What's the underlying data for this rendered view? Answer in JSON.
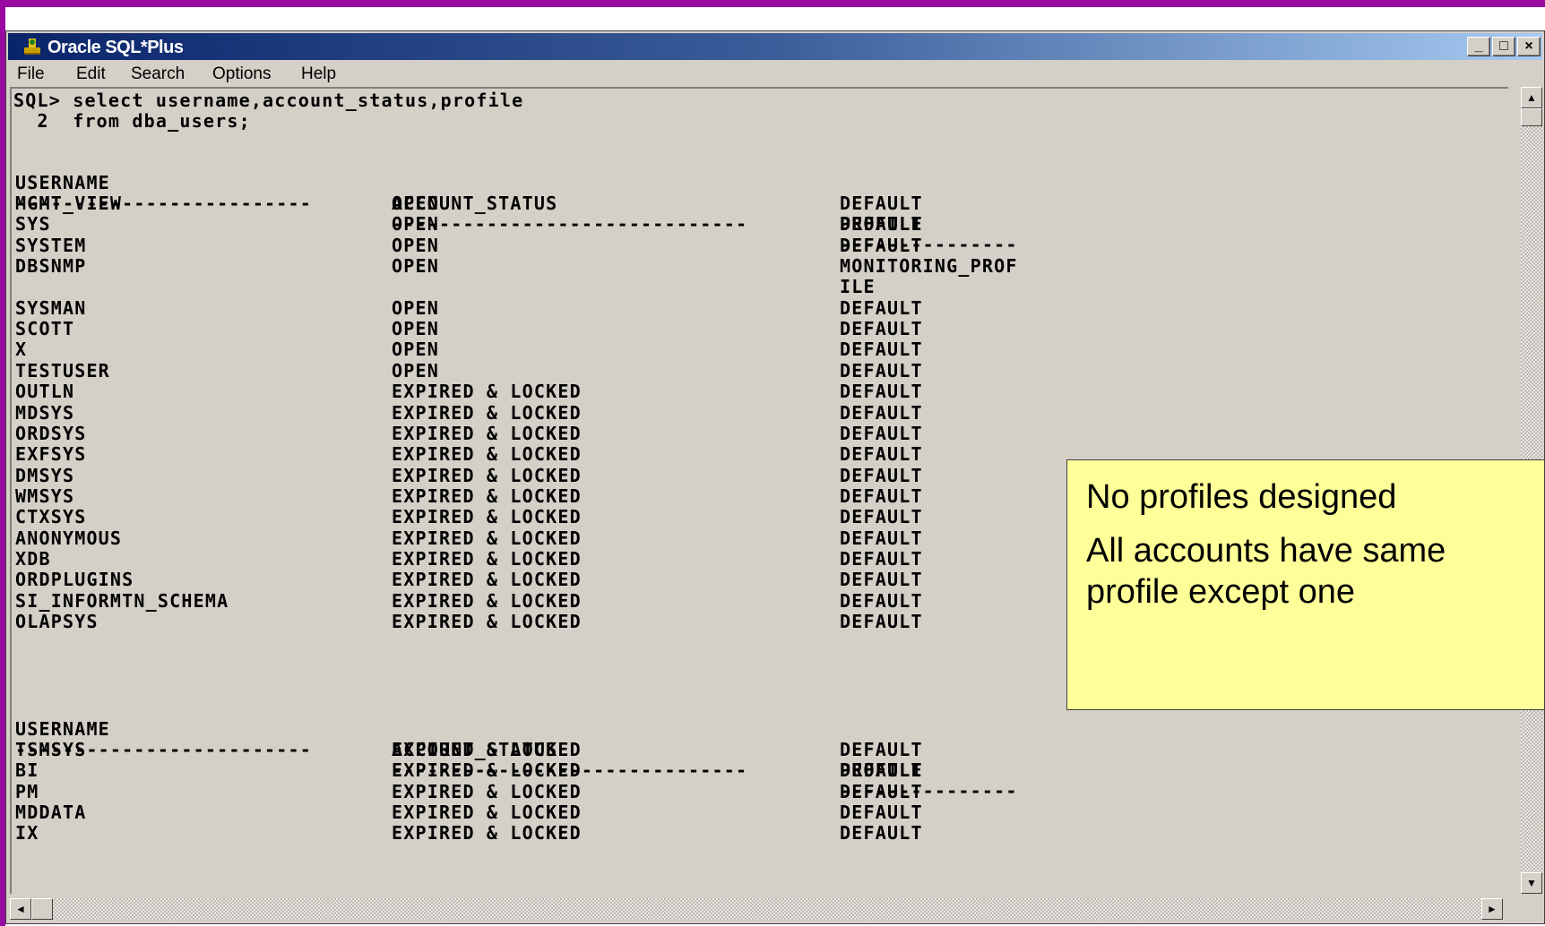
{
  "window": {
    "title": "Oracle SQL*Plus",
    "buttons": {
      "minimize": "_",
      "maximize": "□",
      "close": "×"
    }
  },
  "menu": [
    "File",
    "Edit",
    "Search",
    "Options",
    "Help"
  ],
  "console": {
    "prompt_line1": "SQL> select username,account_status,profile",
    "prompt_line2": "  2  from dba_users;",
    "headers": {
      "username": "USERNAME",
      "account_status": "ACCOUNT_STATUS",
      "profile": "PROFILE"
    },
    "separators": {
      "username": "-------------------------",
      "account_status": "------------------------------",
      "profile": "---------------"
    },
    "rows_page1": [
      {
        "username": "MGMT_VIEW",
        "status": "OPEN",
        "profile": "DEFAULT"
      },
      {
        "username": "SYS",
        "status": "OPEN",
        "profile": "DEFAULT"
      },
      {
        "username": "SYSTEM",
        "status": "OPEN",
        "profile": "DEFAULT"
      },
      {
        "username": "DBSNMP",
        "status": "OPEN",
        "profile": "MONITORING_PROF"
      },
      {
        "username": "",
        "status": "",
        "profile": "ILE"
      },
      {
        "username": "SYSMAN",
        "status": "OPEN",
        "profile": "DEFAULT"
      },
      {
        "username": "SCOTT",
        "status": "OPEN",
        "profile": "DEFAULT"
      },
      {
        "username": "X",
        "status": "OPEN",
        "profile": "DEFAULT"
      },
      {
        "username": "TESTUSER",
        "status": "OPEN",
        "profile": "DEFAULT"
      },
      {
        "username": "OUTLN",
        "status": "EXPIRED & LOCKED",
        "profile": "DEFAULT"
      },
      {
        "username": "MDSYS",
        "status": "EXPIRED & LOCKED",
        "profile": "DEFAULT"
      },
      {
        "username": "ORDSYS",
        "status": "EXPIRED & LOCKED",
        "profile": "DEFAULT"
      },
      {
        "username": "EXFSYS",
        "status": "EXPIRED & LOCKED",
        "profile": "DEFAULT"
      },
      {
        "username": "DMSYS",
        "status": "EXPIRED & LOCKED",
        "profile": "DEFAULT"
      },
      {
        "username": "WMSYS",
        "status": "EXPIRED & LOCKED",
        "profile": "DEFAULT"
      },
      {
        "username": "CTXSYS",
        "status": "EXPIRED & LOCKED",
        "profile": "DEFAULT"
      },
      {
        "username": "ANONYMOUS",
        "status": "EXPIRED & LOCKED",
        "profile": "DEFAULT"
      },
      {
        "username": "XDB",
        "status": "EXPIRED & LOCKED",
        "profile": "DEFAULT"
      },
      {
        "username": "ORDPLUGINS",
        "status": "EXPIRED & LOCKED",
        "profile": "DEFAULT"
      },
      {
        "username": "SI_INFORMTN_SCHEMA",
        "status": "EXPIRED & LOCKED",
        "profile": "DEFAULT"
      },
      {
        "username": "OLAPSYS",
        "status": "EXPIRED & LOCKED",
        "profile": "DEFAULT"
      }
    ],
    "rows_page2": [
      {
        "username": "TSMSYS",
        "status": "EXPIRED & LOCKED",
        "profile": "DEFAULT"
      },
      {
        "username": "BI",
        "status": "EXPIRED & LOCKED",
        "profile": "DEFAULT"
      },
      {
        "username": "PM",
        "status": "EXPIRED & LOCKED",
        "profile": "DEFAULT"
      },
      {
        "username": "MDDATA",
        "status": "EXPIRED & LOCKED",
        "profile": "DEFAULT"
      },
      {
        "username": "IX",
        "status": "EXPIRED & LOCKED",
        "profile": "DEFAULT"
      }
    ]
  },
  "callout": {
    "line1": "No profiles designed",
    "line2": "All accounts have same profile except one"
  },
  "icons": {
    "app": "oracle-sqlplus-icon"
  },
  "colors": {
    "frame": "#980aa0",
    "titlebar": "#0a246a",
    "console_bg": "#d4d0c8",
    "callout_bg": "#ffff99"
  }
}
